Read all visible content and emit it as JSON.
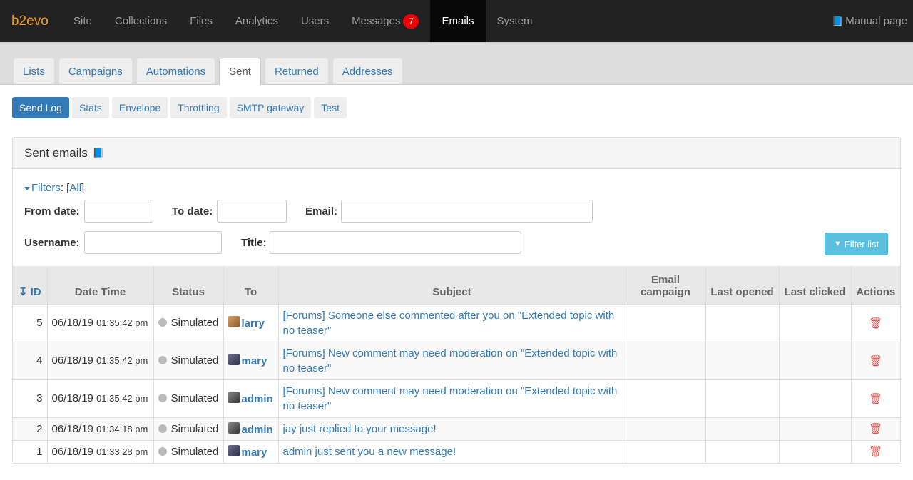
{
  "topnav": {
    "brand": "b2evo",
    "items": [
      "Site",
      "Collections",
      "Files",
      "Analytics",
      "Users",
      "Messages",
      "Emails",
      "System"
    ],
    "messages_badge": "7",
    "manual_label": "Manual page"
  },
  "tabs": [
    "Lists",
    "Campaigns",
    "Automations",
    "Sent",
    "Returned",
    "Addresses"
  ],
  "subtabs": [
    "Send Log",
    "Stats",
    "Envelope",
    "Throttling",
    "SMTP gateway",
    "Test"
  ],
  "panel": {
    "title": "Sent emails",
    "filters": {
      "toggle": "Filters",
      "all_link": "All",
      "from_date_label": "From date:",
      "to_date_label": "To date:",
      "email_label": "Email:",
      "username_label": "Username:",
      "title_label": "Title:",
      "button": "Filter list"
    },
    "table": {
      "headers": [
        "ID",
        "Date Time",
        "Status",
        "To",
        "Subject",
        "Email campaign",
        "Last opened",
        "Last clicked",
        "Actions"
      ],
      "rows": [
        {
          "id": "5",
          "date": "06/18/19",
          "time": "01:35:42 pm",
          "status": "Simulated",
          "to": "larry",
          "avatar": "larry",
          "subject": "[Forums] Someone else commented after you on \"Extended topic with no teaser\""
        },
        {
          "id": "4",
          "date": "06/18/19",
          "time": "01:35:42 pm",
          "status": "Simulated",
          "to": "mary",
          "avatar": "mary",
          "subject": "[Forums] New comment may need moderation on \"Extended topic with no teaser\""
        },
        {
          "id": "3",
          "date": "06/18/19",
          "time": "01:35:42 pm",
          "status": "Simulated",
          "to": "admin",
          "avatar": "admin",
          "subject": "[Forums] New comment may need moderation on \"Extended topic with no teaser\""
        },
        {
          "id": "2",
          "date": "06/18/19",
          "time": "01:34:18 pm",
          "status": "Simulated",
          "to": "admin",
          "avatar": "admin",
          "subject": "jay just replied to your message!"
        },
        {
          "id": "1",
          "date": "06/18/19",
          "time": "01:33:28 pm",
          "status": "Simulated",
          "to": "mary",
          "avatar": "mary",
          "subject": "admin just sent you a new message!"
        }
      ]
    }
  }
}
